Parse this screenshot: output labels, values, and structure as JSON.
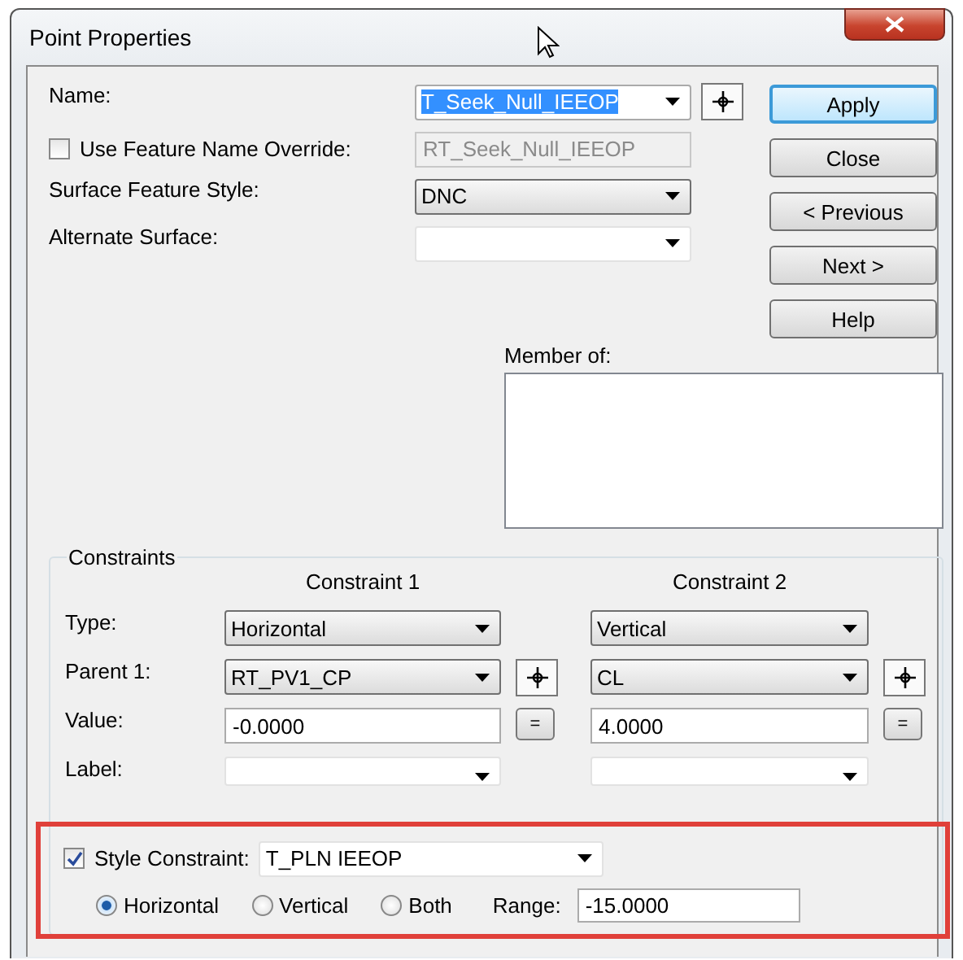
{
  "window": {
    "title": "Point Properties"
  },
  "name": {
    "label": "Name:",
    "value": "T_Seek_Null_IEEOP",
    "highlighted": true
  },
  "feature_name_override": {
    "label": "Use Feature Name Override:",
    "checked": false,
    "value": "RT_Seek_Null_IEEOP",
    "disabled": true
  },
  "surface_feature_style": {
    "label": "Surface Feature Style:",
    "value": "DNC"
  },
  "alternate_surface": {
    "label": "Alternate Surface:"
  },
  "buttons": [
    {
      "label": "Apply",
      "default": true
    },
    {
      "label": "Close",
      "default": false
    },
    {
      "label": "< Previous",
      "default": false
    },
    {
      "label": "Next >",
      "default": false
    },
    {
      "label": "Help",
      "default": false
    }
  ],
  "member_of": {
    "label": "Member of:"
  },
  "constraints": {
    "title": "Constraints",
    "row_labels": [
      "Type:",
      "Parent 1:",
      "Value:",
      "Label:"
    ],
    "columns": [
      {
        "header": "Constraint 1",
        "type": "Horizontal",
        "parent": "RT_PV1_CP",
        "value": "-0.0000",
        "equals": "="
      },
      {
        "header": "Constraint 2",
        "type": "Vertical",
        "parent": "CL",
        "value": "4.0000",
        "equals": "="
      }
    ]
  },
  "style_constraint": {
    "label": "Style Constraint:",
    "checked": true,
    "value": "T_PLN IEEOP",
    "orientations": [
      {
        "label": "Horizontal",
        "selected": true
      },
      {
        "label": "Vertical",
        "selected": false
      },
      {
        "label": "Both",
        "selected": false
      }
    ],
    "range_label": "Range:",
    "range": "-15.0000"
  }
}
